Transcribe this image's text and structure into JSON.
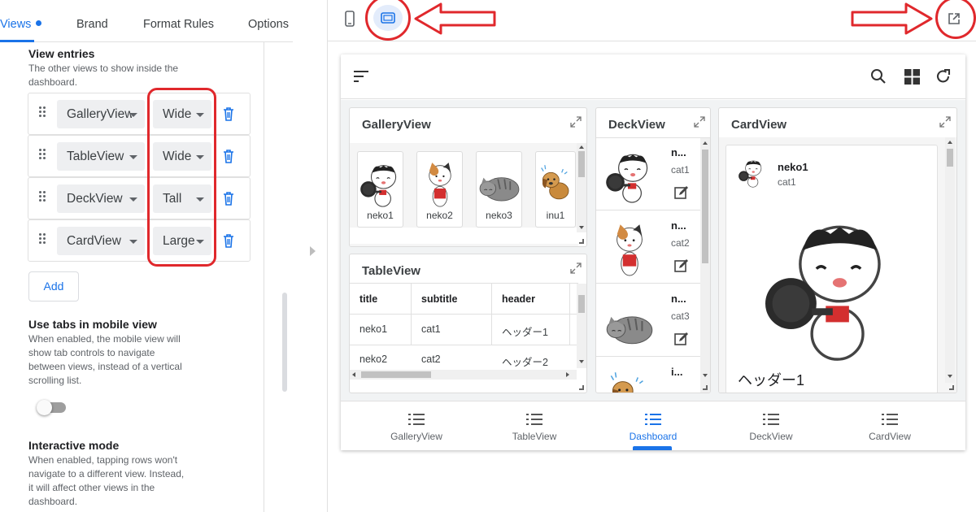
{
  "tabs": [
    {
      "label": "Views",
      "active": true,
      "has_dot": true
    },
    {
      "label": "Brand",
      "active": false
    },
    {
      "label": "Format Rules",
      "active": false
    },
    {
      "label": "Options",
      "active": false
    }
  ],
  "view_entries": {
    "title": "View entries",
    "description": "The other views to show inside the dashboard.",
    "entries": [
      {
        "view": "GalleryView",
        "size": "Wide"
      },
      {
        "view": "TableView",
        "size": "Wide"
      },
      {
        "view": "DeckView",
        "size": "Tall"
      },
      {
        "view": "CardView",
        "size": "Large"
      }
    ],
    "add_label": "Add"
  },
  "use_tabs": {
    "title": "Use tabs in mobile view",
    "description": "When enabled, the mobile view will show tab controls to navigate between views, instead of a vertical scrolling list.",
    "enabled": false
  },
  "interactive_mode": {
    "title": "Interactive mode",
    "description": "When enabled, tapping rows won't navigate to a different view. Instead, it will affect other views in the dashboard."
  },
  "preview_toolbar": {
    "icons": [
      "phone-icon",
      "tablet-icon",
      "open-external-icon"
    ],
    "selected": "tablet-icon"
  },
  "dashboard": {
    "header_icons": [
      "sort-icon",
      "search-icon",
      "grid-icon",
      "refresh-icon"
    ],
    "gallery": {
      "title": "GalleryView",
      "items": [
        {
          "label": "neko1",
          "image": "cat-chef"
        },
        {
          "label": "neko2",
          "image": "cat-calico"
        },
        {
          "label": "neko3",
          "image": "cat-gray"
        },
        {
          "label": "inu1",
          "image": "dog"
        }
      ]
    },
    "table": {
      "title": "TableView",
      "columns": [
        "title",
        "subtitle",
        "header"
      ],
      "rows": [
        [
          "neko1",
          "cat1",
          "ヘッダー1"
        ],
        [
          "neko2",
          "cat2",
          "ヘッダー2"
        ]
      ]
    },
    "deck": {
      "title": "DeckView",
      "rows": [
        {
          "title": "n...",
          "subtitle": "cat1"
        },
        {
          "title": "n...",
          "subtitle": "cat2"
        },
        {
          "title": "n...",
          "subtitle": "cat3"
        },
        {
          "title": "i...",
          "subtitle": ""
        }
      ]
    },
    "card": {
      "title": "CardView",
      "item_title": "neko1",
      "item_subtitle": "cat1",
      "item_header": "ヘッダー1"
    },
    "footer": [
      {
        "label": "GalleryView",
        "active": false
      },
      {
        "label": "TableView",
        "active": false
      },
      {
        "label": "Dashboard",
        "active": true
      },
      {
        "label": "DeckView",
        "active": false
      },
      {
        "label": "CardView",
        "active": false
      }
    ]
  },
  "colors": {
    "accent": "#1a73e8",
    "annotation_red": "#e0282c",
    "delete_icon": "#1a73e8"
  }
}
